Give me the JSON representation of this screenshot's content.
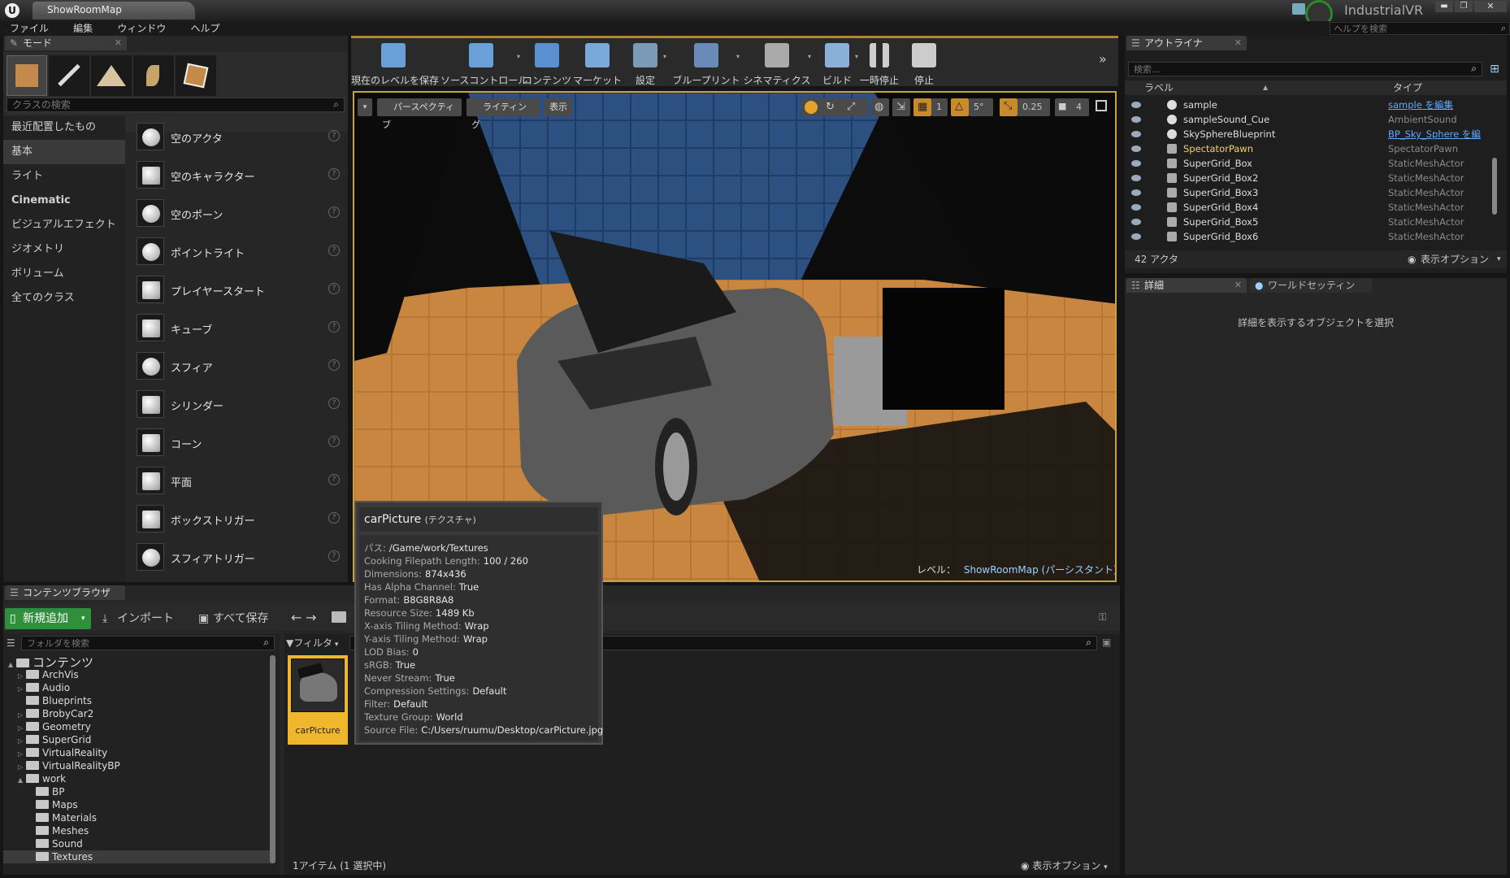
{
  "window": {
    "tab_title": "ShowRoomMap",
    "project": "IndustrialVR",
    "help_placeholder": "ヘルプを検索"
  },
  "menu": [
    "ファイル",
    "編集",
    "ウィンドウ",
    "ヘルプ"
  ],
  "modes": {
    "tab": "モード",
    "search_placeholder": "クラスの検索",
    "categories": [
      "最近配置したもの",
      "基本",
      "ライト",
      "Cinematic",
      "ビジュアルエフェクト",
      "ジオメトリ",
      "ボリューム",
      "全てのクラス"
    ],
    "selected_category": "基本",
    "items": [
      "空のアクタ",
      "空のキャラクター",
      "空のポーン",
      "ポイントライト",
      "プレイヤースタート",
      "キューブ",
      "スフィア",
      "シリンダー",
      "コーン",
      "平面",
      "ボックストリガー",
      "スフィアトリガー"
    ]
  },
  "toolbar": [
    {
      "label": "現在のレベルを保存",
      "icon": "save-icon"
    },
    {
      "label": "ソースコントロール",
      "icon": "source-control-icon"
    },
    {
      "label": "コンテンツ",
      "icon": "content-icon"
    },
    {
      "label": "マーケット",
      "icon": "marketplace-icon"
    },
    {
      "label": "設定",
      "icon": "settings-icon"
    },
    {
      "label": "ブループリント",
      "icon": "blueprint-icon"
    },
    {
      "label": "シネマティクス",
      "icon": "cinematics-icon"
    },
    {
      "label": "ビルド",
      "icon": "build-icon"
    },
    {
      "label": "一時停止",
      "icon": "pause-icon"
    },
    {
      "label": "停止",
      "icon": "stop-icon"
    }
  ],
  "viewport": {
    "perspective": "パースペクティブ",
    "lighting": "ライティング",
    "show": "表示",
    "rotate_snap": "5°",
    "scale_snap": "0.25",
    "grid_snap": "1",
    "camera_speed": "4",
    "level_label": "レベル：",
    "level_name": "ShowRoomMap (パーシスタント)"
  },
  "outliner": {
    "tab": "アウトライナ",
    "search_placeholder": "検索...",
    "col_label": "ラベル",
    "col_type": "タイプ",
    "rows": [
      {
        "name": "sample",
        "type": "sample を編集",
        "link": true,
        "highlight": false
      },
      {
        "name": "sampleSound_Cue",
        "type": "AmbientSound",
        "link": false,
        "highlight": false
      },
      {
        "name": "SkySphereBlueprint",
        "type": "BP_Sky_Sphere を編",
        "link": true,
        "highlight": false
      },
      {
        "name": "SpectatorPawn",
        "type": "SpectatorPawn",
        "link": false,
        "highlight": true
      },
      {
        "name": "SuperGrid_Box",
        "type": "StaticMeshActor",
        "link": false,
        "highlight": false
      },
      {
        "name": "SuperGrid_Box2",
        "type": "StaticMeshActor",
        "link": false,
        "highlight": false
      },
      {
        "name": "SuperGrid_Box3",
        "type": "StaticMeshActor",
        "link": false,
        "highlight": false
      },
      {
        "name": "SuperGrid_Box4",
        "type": "StaticMeshActor",
        "link": false,
        "highlight": false
      },
      {
        "name": "SuperGrid_Box5",
        "type": "StaticMeshActor",
        "link": false,
        "highlight": false
      },
      {
        "name": "SuperGrid_Box6",
        "type": "StaticMeshActor",
        "link": false,
        "highlight": false
      }
    ],
    "count": "42 アクタ",
    "view_options": "表示オプション"
  },
  "details": {
    "tab1": "詳細",
    "tab2": "ワールドセッティン",
    "empty_message": "詳細を表示するオブジェクトを選択"
  },
  "content_browser": {
    "tab": "コンテンツブラウザ",
    "add_new": "新規追加",
    "import": "インポート",
    "save_all": "すべて保存",
    "folder_search_placeholder": "フォルダを検索",
    "filter": "フィルタ",
    "tree": [
      {
        "label": "コンテンツ",
        "depth": 0,
        "arrow": "▲",
        "selected": false
      },
      {
        "label": "ArchVis",
        "depth": 1,
        "arrow": "▷",
        "selected": false
      },
      {
        "label": "Audio",
        "depth": 1,
        "arrow": "▷",
        "selected": false
      },
      {
        "label": "Blueprints",
        "depth": 1,
        "arrow": "",
        "selected": false
      },
      {
        "label": "BrobyCar2",
        "depth": 1,
        "arrow": "▷",
        "selected": false
      },
      {
        "label": "Geometry",
        "depth": 1,
        "arrow": "▷",
        "selected": false
      },
      {
        "label": "SuperGrid",
        "depth": 1,
        "arrow": "▷",
        "selected": false
      },
      {
        "label": "VirtualReality",
        "depth": 1,
        "arrow": "▷",
        "selected": false
      },
      {
        "label": "VirtualRealityBP",
        "depth": 1,
        "arrow": "▷",
        "selected": false
      },
      {
        "label": "work",
        "depth": 1,
        "arrow": "▲",
        "selected": false
      },
      {
        "label": "BP",
        "depth": 2,
        "arrow": "",
        "selected": false
      },
      {
        "label": "Maps",
        "depth": 2,
        "arrow": "",
        "selected": false
      },
      {
        "label": "Materials",
        "depth": 2,
        "arrow": "",
        "selected": false
      },
      {
        "label": "Meshes",
        "depth": 2,
        "arrow": "",
        "selected": false
      },
      {
        "label": "Sound",
        "depth": 2,
        "arrow": "",
        "selected": false
      },
      {
        "label": "Textures",
        "depth": 2,
        "arrow": "",
        "selected": true
      }
    ],
    "asset_name": "carPicture",
    "status": "1アイテム (1 選択中)",
    "view_options": "表示オプション"
  },
  "tooltip": {
    "title": "carPicture",
    "title_type": "(テクスチャ)",
    "props": [
      {
        "k": "パス:",
        "v": "/Game/work/Textures"
      },
      {
        "k": "Cooking Filepath Length:",
        "v": "100 / 260"
      },
      {
        "k": "Dimensions:",
        "v": "874x436"
      },
      {
        "k": "Has Alpha Channel:",
        "v": "True"
      },
      {
        "k": "Format:",
        "v": "B8G8R8A8"
      },
      {
        "k": "Resource Size:",
        "v": "1489 Kb"
      },
      {
        "k": "X-axis Tiling Method:",
        "v": "Wrap"
      },
      {
        "k": "Y-axis Tiling Method:",
        "v": "Wrap"
      },
      {
        "k": "LOD Bias:",
        "v": "0"
      },
      {
        "k": "sRGB:",
        "v": "True"
      },
      {
        "k": "Never Stream:",
        "v": "True"
      },
      {
        "k": "Compression Settings:",
        "v": "Default"
      },
      {
        "k": "Filter:",
        "v": "Default"
      },
      {
        "k": "Texture Group:",
        "v": "World"
      },
      {
        "k": "Source File:",
        "v": "C:/Users/ruumu/Desktop/carPicture.jpg"
      }
    ]
  },
  "colors": {
    "accent": "#e8a22a",
    "selection": "#f1b72c",
    "link": "#5fa8ff",
    "add_new": "#2f8f3a"
  }
}
